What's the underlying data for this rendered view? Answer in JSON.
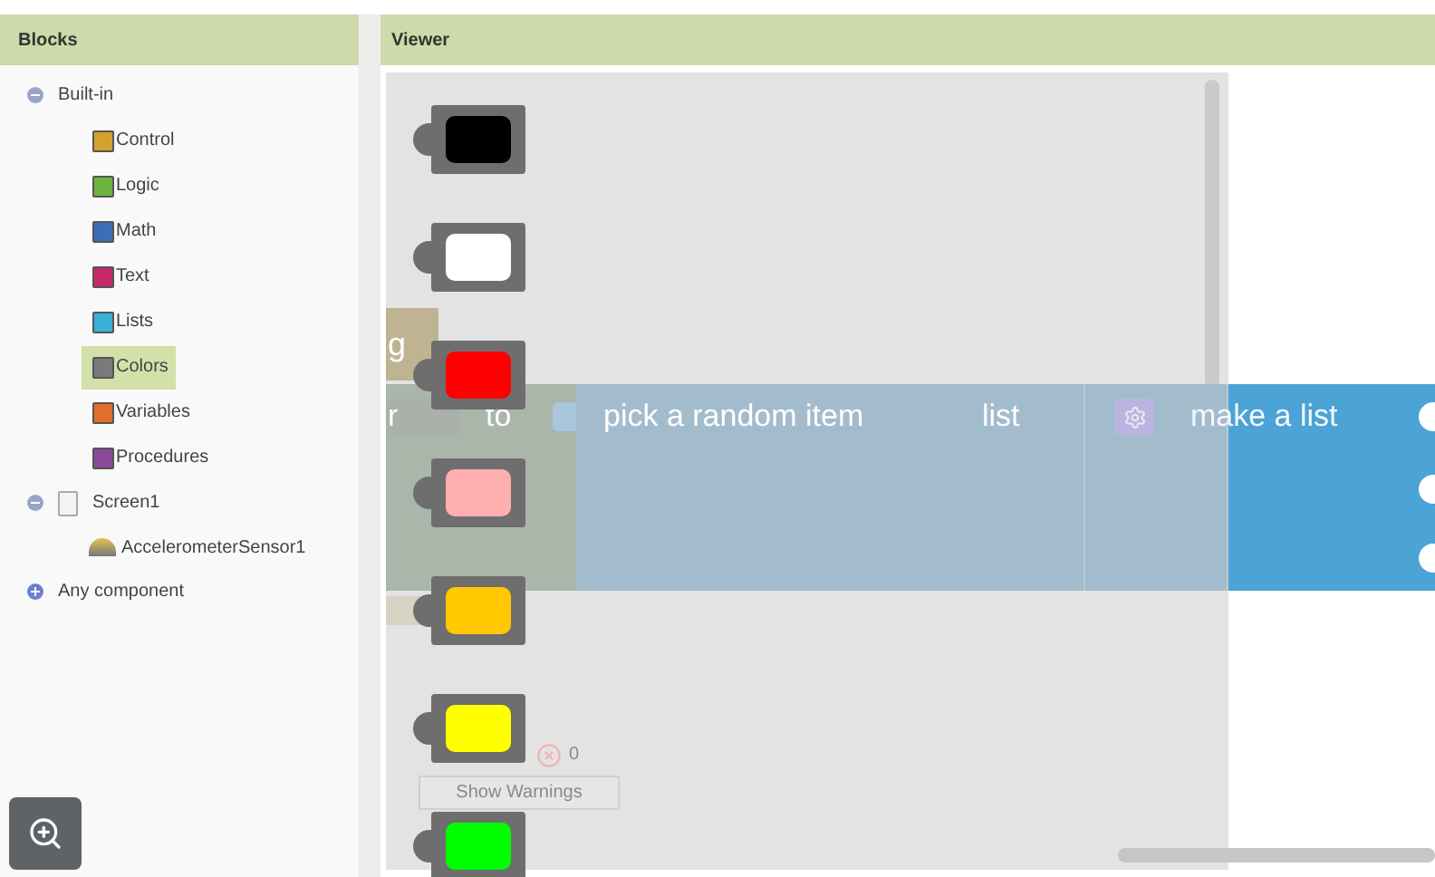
{
  "sidebar": {
    "title": "Blocks",
    "tree": [
      {
        "kind": "folder",
        "label": "Built-in",
        "expanded": true,
        "children": [
          {
            "kind": "category",
            "label": "Control",
            "color": "#d4a22c",
            "selected": false
          },
          {
            "kind": "category",
            "label": "Logic",
            "color": "#6fb33f",
            "selected": false
          },
          {
            "kind": "category",
            "label": "Math",
            "color": "#3a6fb5",
            "selected": false
          },
          {
            "kind": "category",
            "label": "Text",
            "color": "#c42a6a",
            "selected": false
          },
          {
            "kind": "category",
            "label": "Lists",
            "color": "#3ab0d8",
            "selected": false
          },
          {
            "kind": "category",
            "label": "Colors",
            "color": "#7a7a7a",
            "selected": true
          },
          {
            "kind": "category",
            "label": "Variables",
            "color": "#e0702c",
            "selected": false
          },
          {
            "kind": "category",
            "label": "Procedures",
            "color": "#8a4a9a",
            "selected": false
          }
        ]
      },
      {
        "kind": "screen",
        "label": "Screen1",
        "expanded": true,
        "children": [
          {
            "kind": "sensor",
            "label": "AccelerometerSensor1"
          }
        ]
      },
      {
        "kind": "folder",
        "label": "Any component",
        "expanded": false
      }
    ]
  },
  "viewer": {
    "title": "Viewer",
    "flyout": {
      "color_blocks": [
        {
          "color": "#000000"
        },
        {
          "color": "#ffffff"
        },
        {
          "color": "#ff0000"
        },
        {
          "color": "#ffafaf"
        },
        {
          "color": "#ffc800"
        },
        {
          "color": "#ffff00"
        },
        {
          "color": "#00ff00"
        }
      ]
    },
    "workspace": {
      "fragment_top": "g",
      "fragment_left": "r",
      "to_label": "to",
      "pick_label": "pick a random item",
      "list_label": "list",
      "make_list_label": "make a list"
    },
    "warnings": {
      "count": "0",
      "button": "Show Warnings"
    }
  }
}
